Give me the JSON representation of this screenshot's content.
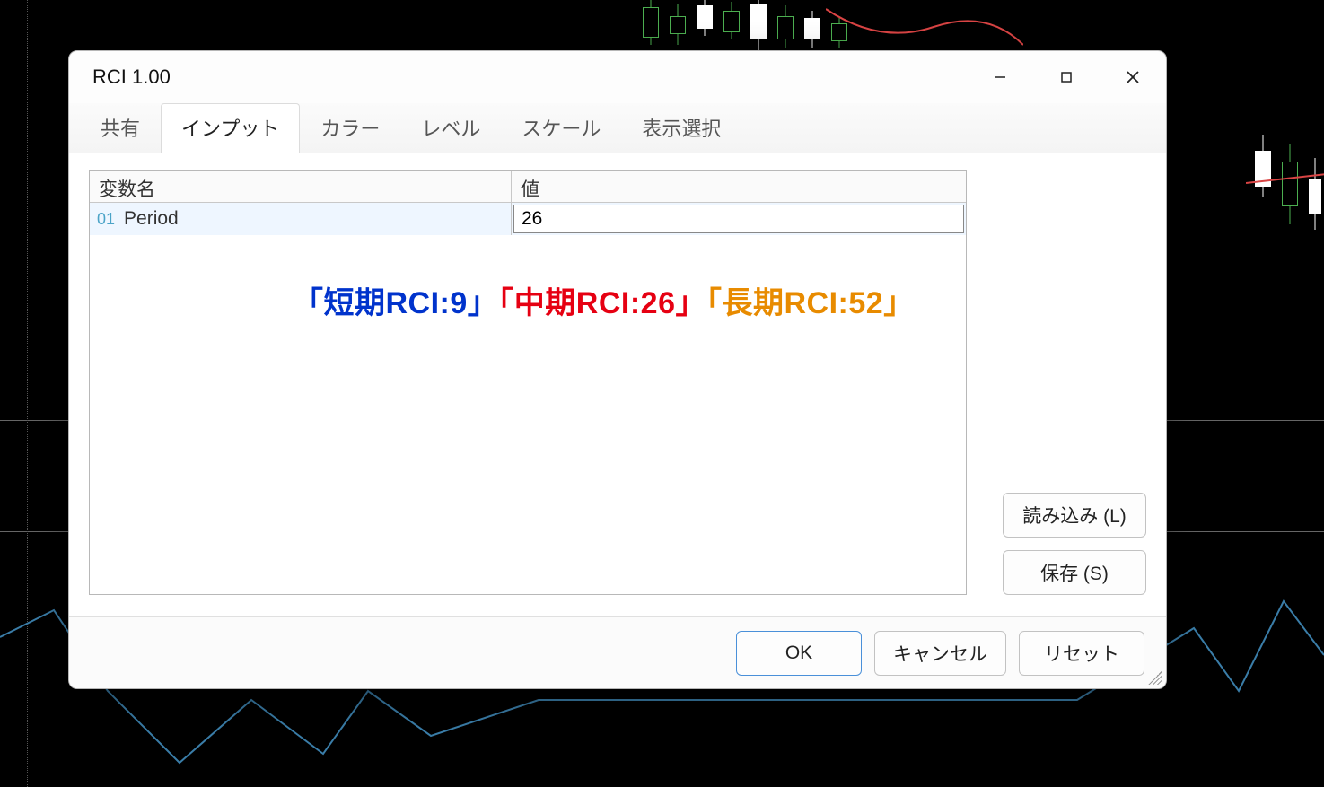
{
  "window": {
    "title": "RCI 1.00"
  },
  "tabs": [
    {
      "label": "共有"
    },
    {
      "label": "インプット"
    },
    {
      "label": "カラー"
    },
    {
      "label": "レベル"
    },
    {
      "label": "スケール"
    },
    {
      "label": "表示選択"
    }
  ],
  "active_tab_index": 1,
  "grid": {
    "columns": {
      "name": "変数名",
      "value": "値"
    },
    "rows": [
      {
        "num": "01",
        "label": "Period",
        "value": "26"
      }
    ]
  },
  "annotation": {
    "part1": "「短期RCI:9」",
    "part2": "「中期RCI:26」",
    "part3": "「長期RCI:52」"
  },
  "side_buttons": {
    "load": "読み込み (L)",
    "save": "保存 (S)"
  },
  "footer_buttons": {
    "ok": "OK",
    "cancel": "キャンセル",
    "reset": "リセット"
  }
}
